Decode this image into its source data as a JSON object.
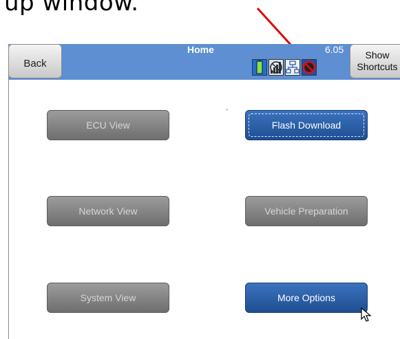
{
  "caption": {
    "text": "up window."
  },
  "header": {
    "back_label": "Back",
    "title": "Home",
    "version": "6.05",
    "shortcuts_label": "Show\nShortcuts"
  },
  "status_icons": [
    "battery-icon",
    "signal-icon",
    "network-icon",
    "blocked-icon"
  ],
  "buttons": {
    "ecu_view": "ECU View",
    "flash_download": "Flash Download",
    "network_view": "Network View",
    "vehicle_preparation": "Vehicle Preparation",
    "system_view": "System View",
    "more_options": "More Options"
  },
  "colors": {
    "titlebar": "#5d8fd2",
    "active_button": "#2a5fa8",
    "disabled_button": "#8a8a8a",
    "annotation_arrow": "#e00000"
  }
}
